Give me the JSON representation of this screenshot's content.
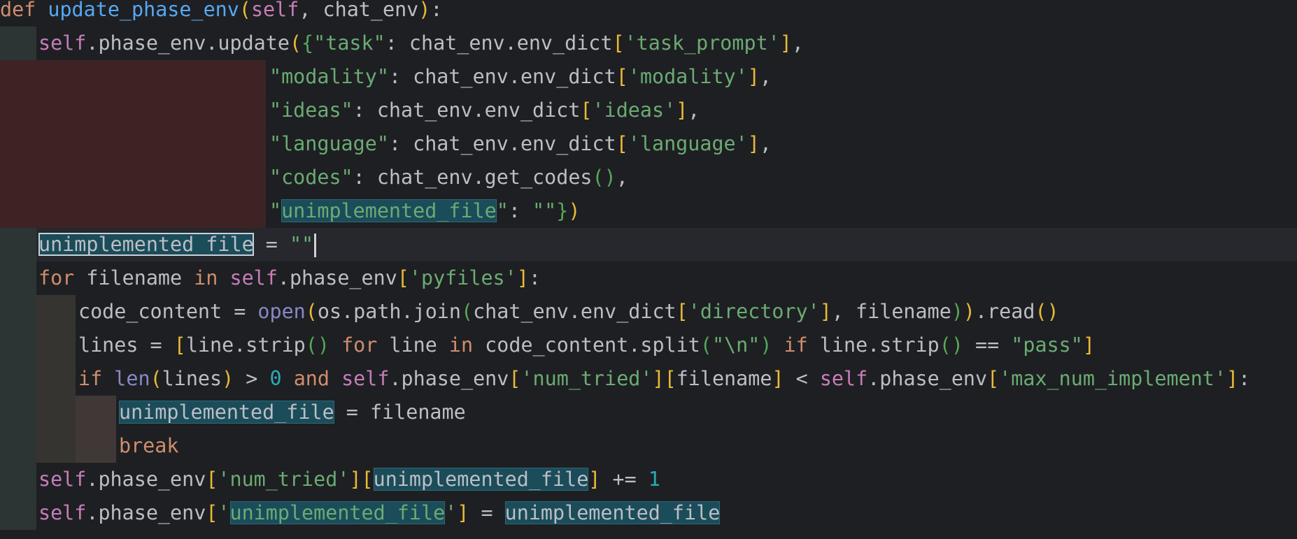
{
  "colors": {
    "background": "#1e1f22",
    "current_line": "#26282e",
    "guide_dark_green": "#2c3533",
    "guide_dark_red": "#3e2325",
    "guide_gray": "#353431",
    "guide_brown": "#403837",
    "identifier_highlight": "#1b4c5a",
    "keyword": "#cf8e6d",
    "self": "#c77dba",
    "function_def": "#56a8f5",
    "string": "#6aab73",
    "number": "#2aacb8",
    "default": "#bcbec4",
    "bracket_gold": "#e8ba36",
    "bracket_green": "#54a857",
    "builtin": "#8888c6"
  },
  "editor": {
    "lines": [
      {
        "tokens": [
          {
            "t": "def",
            "c": "keyword"
          },
          {
            "t": " ",
            "c": "default"
          },
          {
            "t": "update_phase_env",
            "c": "function_def"
          },
          {
            "t": "(",
            "c": "bracket_gold"
          },
          {
            "t": "self",
            "c": "self"
          },
          {
            "t": ", chat_env",
            "c": "default"
          },
          {
            "t": ")",
            "c": "bracket_gold"
          },
          {
            "t": ":",
            "c": "default"
          }
        ]
      },
      {
        "tokens": [
          {
            "t": "self",
            "c": "self"
          },
          {
            "t": ".phase_env.update",
            "c": "default"
          },
          {
            "t": "(",
            "c": "bracket_gold"
          },
          {
            "t": "{",
            "c": "bracket_green"
          },
          {
            "t": "\"task\"",
            "c": "string"
          },
          {
            "t": ": chat_env.env_dict",
            "c": "default"
          },
          {
            "t": "[",
            "c": "bracket_gold"
          },
          {
            "t": "'task_prompt'",
            "c": "string"
          },
          {
            "t": "]",
            "c": "bracket_gold"
          },
          {
            "t": ",",
            "c": "default"
          }
        ]
      },
      {
        "tokens": [
          {
            "t": "\"modality\"",
            "c": "string"
          },
          {
            "t": ": chat_env.env_dict",
            "c": "default"
          },
          {
            "t": "[",
            "c": "bracket_gold"
          },
          {
            "t": "'modality'",
            "c": "string"
          },
          {
            "t": "]",
            "c": "bracket_gold"
          },
          {
            "t": ",",
            "c": "default"
          }
        ]
      },
      {
        "tokens": [
          {
            "t": "\"ideas\"",
            "c": "string"
          },
          {
            "t": ": chat_env.env_dict",
            "c": "default"
          },
          {
            "t": "[",
            "c": "bracket_gold"
          },
          {
            "t": "'ideas'",
            "c": "string"
          },
          {
            "t": "]",
            "c": "bracket_gold"
          },
          {
            "t": ",",
            "c": "default"
          }
        ]
      },
      {
        "tokens": [
          {
            "t": "\"language\"",
            "c": "string"
          },
          {
            "t": ": chat_env.env_dict",
            "c": "default"
          },
          {
            "t": "[",
            "c": "bracket_gold"
          },
          {
            "t": "'language'",
            "c": "string"
          },
          {
            "t": "]",
            "c": "bracket_gold"
          },
          {
            "t": ",",
            "c": "default"
          }
        ]
      },
      {
        "tokens": [
          {
            "t": "\"codes\"",
            "c": "string"
          },
          {
            "t": ": chat_env.get_codes",
            "c": "default"
          },
          {
            "t": "()",
            "c": "bracket_green"
          },
          {
            "t": ",",
            "c": "default"
          }
        ]
      },
      {
        "tokens": [
          {
            "t": "\"",
            "c": "string"
          },
          {
            "t": "unimplemented_file",
            "c": "string",
            "hl": true
          },
          {
            "t": "\"",
            "c": "string"
          },
          {
            "t": ": ",
            "c": "default"
          },
          {
            "t": "\"\"",
            "c": "string"
          },
          {
            "t": "}",
            "c": "bracket_green"
          },
          {
            "t": ")",
            "c": "bracket_gold"
          }
        ]
      },
      {
        "tokens": [
          {
            "t": "unimplemented_file",
            "c": "default",
            "hl": "sel"
          },
          {
            "t": " = ",
            "c": "default"
          },
          {
            "t": "\"\"",
            "c": "string"
          },
          {
            "caret": true
          }
        ]
      },
      {
        "tokens": [
          {
            "t": "for",
            "c": "keyword"
          },
          {
            "t": " filename ",
            "c": "default"
          },
          {
            "t": "in",
            "c": "keyword"
          },
          {
            "t": " ",
            "c": "default"
          },
          {
            "t": "self",
            "c": "self"
          },
          {
            "t": ".phase_env",
            "c": "default"
          },
          {
            "t": "[",
            "c": "bracket_gold"
          },
          {
            "t": "'pyfiles'",
            "c": "string"
          },
          {
            "t": "]",
            "c": "bracket_gold"
          },
          {
            "t": ":",
            "c": "default"
          }
        ]
      },
      {
        "tokens": [
          {
            "t": "code_content = ",
            "c": "default"
          },
          {
            "t": "open",
            "c": "builtin"
          },
          {
            "t": "(",
            "c": "bracket_gold"
          },
          {
            "t": "os.path.join",
            "c": "default"
          },
          {
            "t": "(",
            "c": "bracket_green"
          },
          {
            "t": "chat_env.env_dict",
            "c": "default"
          },
          {
            "t": "[",
            "c": "bracket_gold"
          },
          {
            "t": "'directory'",
            "c": "string"
          },
          {
            "t": "]",
            "c": "bracket_gold"
          },
          {
            "t": ", filename",
            "c": "default"
          },
          {
            "t": ")",
            "c": "bracket_green"
          },
          {
            "t": ")",
            "c": "bracket_gold"
          },
          {
            "t": ".read",
            "c": "default"
          },
          {
            "t": "()",
            "c": "bracket_gold"
          }
        ]
      },
      {
        "tokens": [
          {
            "t": "lines = ",
            "c": "default"
          },
          {
            "t": "[",
            "c": "bracket_gold"
          },
          {
            "t": "line.strip",
            "c": "default"
          },
          {
            "t": "()",
            "c": "bracket_green"
          },
          {
            "t": " ",
            "c": "default"
          },
          {
            "t": "for",
            "c": "keyword"
          },
          {
            "t": " line ",
            "c": "default"
          },
          {
            "t": "in",
            "c": "keyword"
          },
          {
            "t": " code_content.split",
            "c": "default"
          },
          {
            "t": "(",
            "c": "bracket_green"
          },
          {
            "t": "\"\\n\"",
            "c": "string"
          },
          {
            "t": ")",
            "c": "bracket_green"
          },
          {
            "t": " ",
            "c": "default"
          },
          {
            "t": "if",
            "c": "keyword"
          },
          {
            "t": " line.strip",
            "c": "default"
          },
          {
            "t": "()",
            "c": "bracket_green"
          },
          {
            "t": " == ",
            "c": "default"
          },
          {
            "t": "\"pass\"",
            "c": "string"
          },
          {
            "t": "]",
            "c": "bracket_gold"
          }
        ]
      },
      {
        "tokens": [
          {
            "t": "if",
            "c": "keyword"
          },
          {
            "t": " ",
            "c": "default"
          },
          {
            "t": "len",
            "c": "builtin"
          },
          {
            "t": "(",
            "c": "bracket_gold"
          },
          {
            "t": "lines",
            "c": "default"
          },
          {
            "t": ")",
            "c": "bracket_gold"
          },
          {
            "t": " > ",
            "c": "default"
          },
          {
            "t": "0",
            "c": "number"
          },
          {
            "t": " ",
            "c": "default"
          },
          {
            "t": "and",
            "c": "keyword"
          },
          {
            "t": " ",
            "c": "default"
          },
          {
            "t": "self",
            "c": "self"
          },
          {
            "t": ".phase_env",
            "c": "default"
          },
          {
            "t": "[",
            "c": "bracket_gold"
          },
          {
            "t": "'num_tried'",
            "c": "string"
          },
          {
            "t": "]",
            "c": "bracket_gold"
          },
          {
            "t": "[",
            "c": "bracket_gold"
          },
          {
            "t": "filename",
            "c": "default"
          },
          {
            "t": "]",
            "c": "bracket_gold"
          },
          {
            "t": " < ",
            "c": "default"
          },
          {
            "t": "self",
            "c": "self"
          },
          {
            "t": ".phase_env",
            "c": "default"
          },
          {
            "t": "[",
            "c": "bracket_gold"
          },
          {
            "t": "'max_num_implement'",
            "c": "string"
          },
          {
            "t": "]",
            "c": "bracket_gold"
          },
          {
            "t": ":",
            "c": "default"
          }
        ]
      },
      {
        "tokens": [
          {
            "t": "unimplemented_file",
            "c": "default",
            "hl": true
          },
          {
            "t": " = filename",
            "c": "default"
          }
        ]
      },
      {
        "tokens": [
          {
            "t": "break",
            "c": "keyword"
          }
        ]
      },
      {
        "tokens": [
          {
            "t": "self",
            "c": "self"
          },
          {
            "t": ".phase_env",
            "c": "default"
          },
          {
            "t": "[",
            "c": "bracket_gold"
          },
          {
            "t": "'num_tried'",
            "c": "string"
          },
          {
            "t": "]",
            "c": "bracket_gold"
          },
          {
            "t": "[",
            "c": "bracket_gold"
          },
          {
            "t": "unimplemented_file",
            "c": "default",
            "hl": true
          },
          {
            "t": "]",
            "c": "bracket_gold"
          },
          {
            "t": " += ",
            "c": "default"
          },
          {
            "t": "1",
            "c": "number"
          }
        ]
      },
      {
        "tokens": [
          {
            "t": "self",
            "c": "self"
          },
          {
            "t": ".phase_env",
            "c": "default"
          },
          {
            "t": "[",
            "c": "bracket_gold"
          },
          {
            "t": "'",
            "c": "string"
          },
          {
            "t": "unimplemented_file",
            "c": "string",
            "hl": true
          },
          {
            "t": "'",
            "c": "string"
          },
          {
            "t": "]",
            "c": "bracket_gold"
          },
          {
            "t": " = ",
            "c": "default"
          },
          {
            "t": "unimplemented_file",
            "c": "default",
            "hl": true
          }
        ]
      }
    ]
  }
}
